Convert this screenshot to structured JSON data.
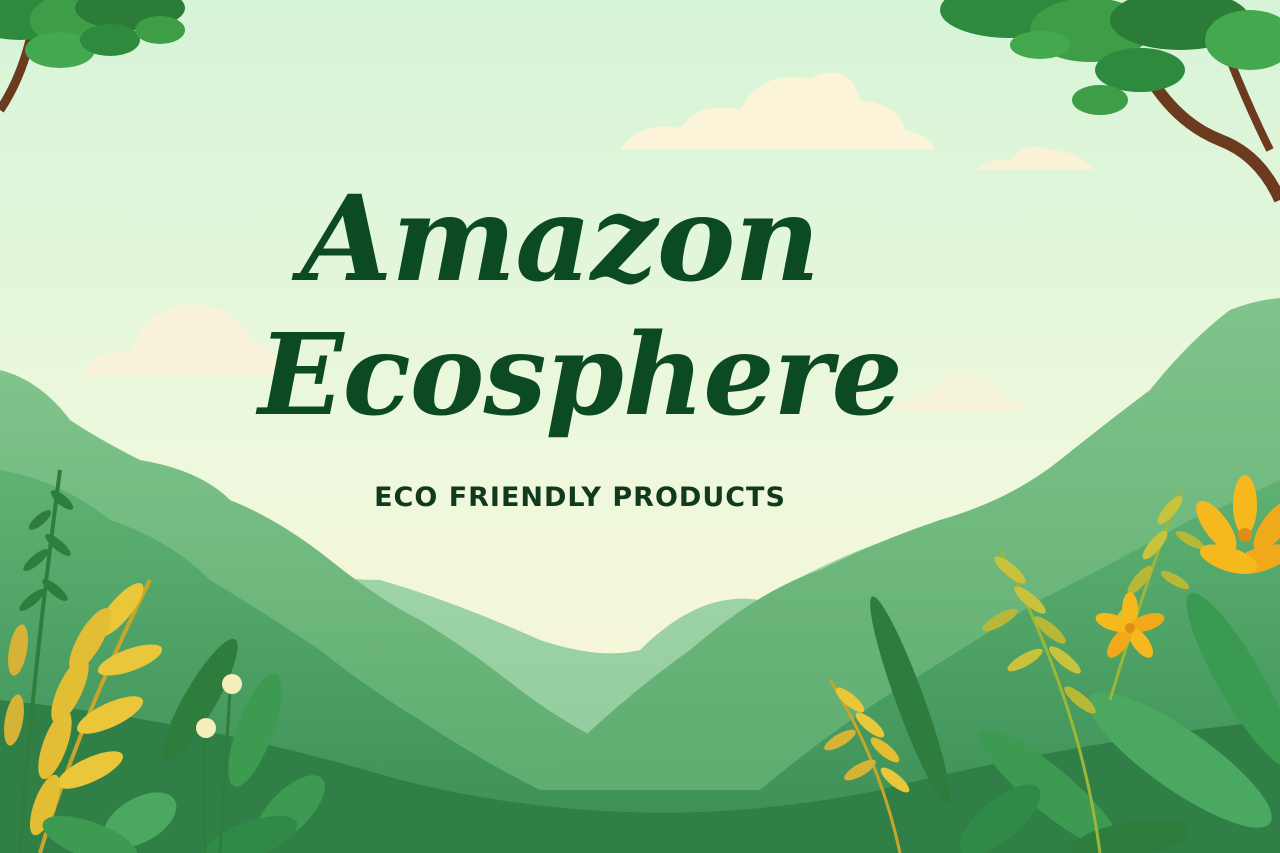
{
  "hero": {
    "title_line1": "Amazon",
    "title_line2": "Ecosphere",
    "tagline": "ECO FRIENDLY PRODUCTS"
  },
  "colors": {
    "title": "#0b4a22",
    "tagline": "#10391e",
    "sky_top": "#d9f6d9",
    "sky_bottom": "#f6f7df",
    "hill_far": "#9fd4a6",
    "hill_mid": "#6cbf7b",
    "hill_near": "#3f9b5d",
    "leaf_yellow": "#e9c63a",
    "leaf_green": "#3c9a51",
    "flower": "#f5b91d",
    "trunk": "#6b3a1f"
  },
  "icons": {
    "decor": [
      "tree-canopy-icon",
      "cloud-icon",
      "flower-icon",
      "leaf-icon",
      "fern-icon"
    ]
  }
}
